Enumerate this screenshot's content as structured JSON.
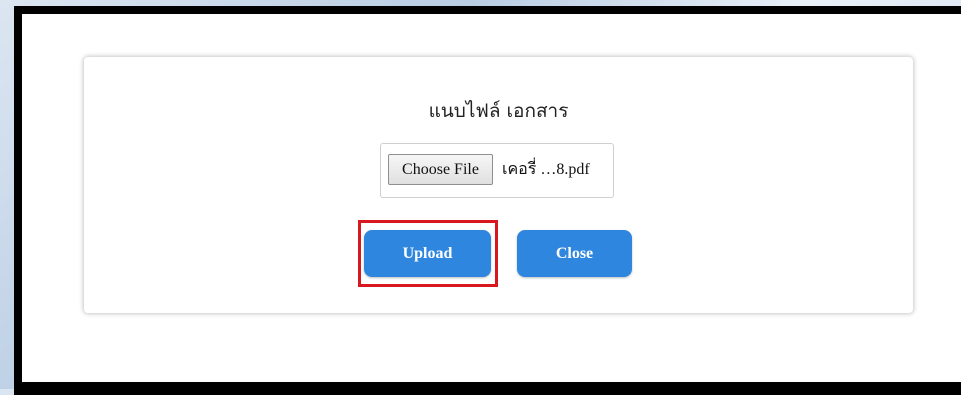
{
  "dialog": {
    "title": "แนบไฟล์ เอกสาร",
    "file_input": {
      "button_label": "Choose File",
      "file_name": "เคอรี่ …8.pdf"
    },
    "upload_label": "Upload",
    "close_label": "Close"
  },
  "colors": {
    "button_bg": "#2f86de",
    "highlight": "#d7191f"
  }
}
